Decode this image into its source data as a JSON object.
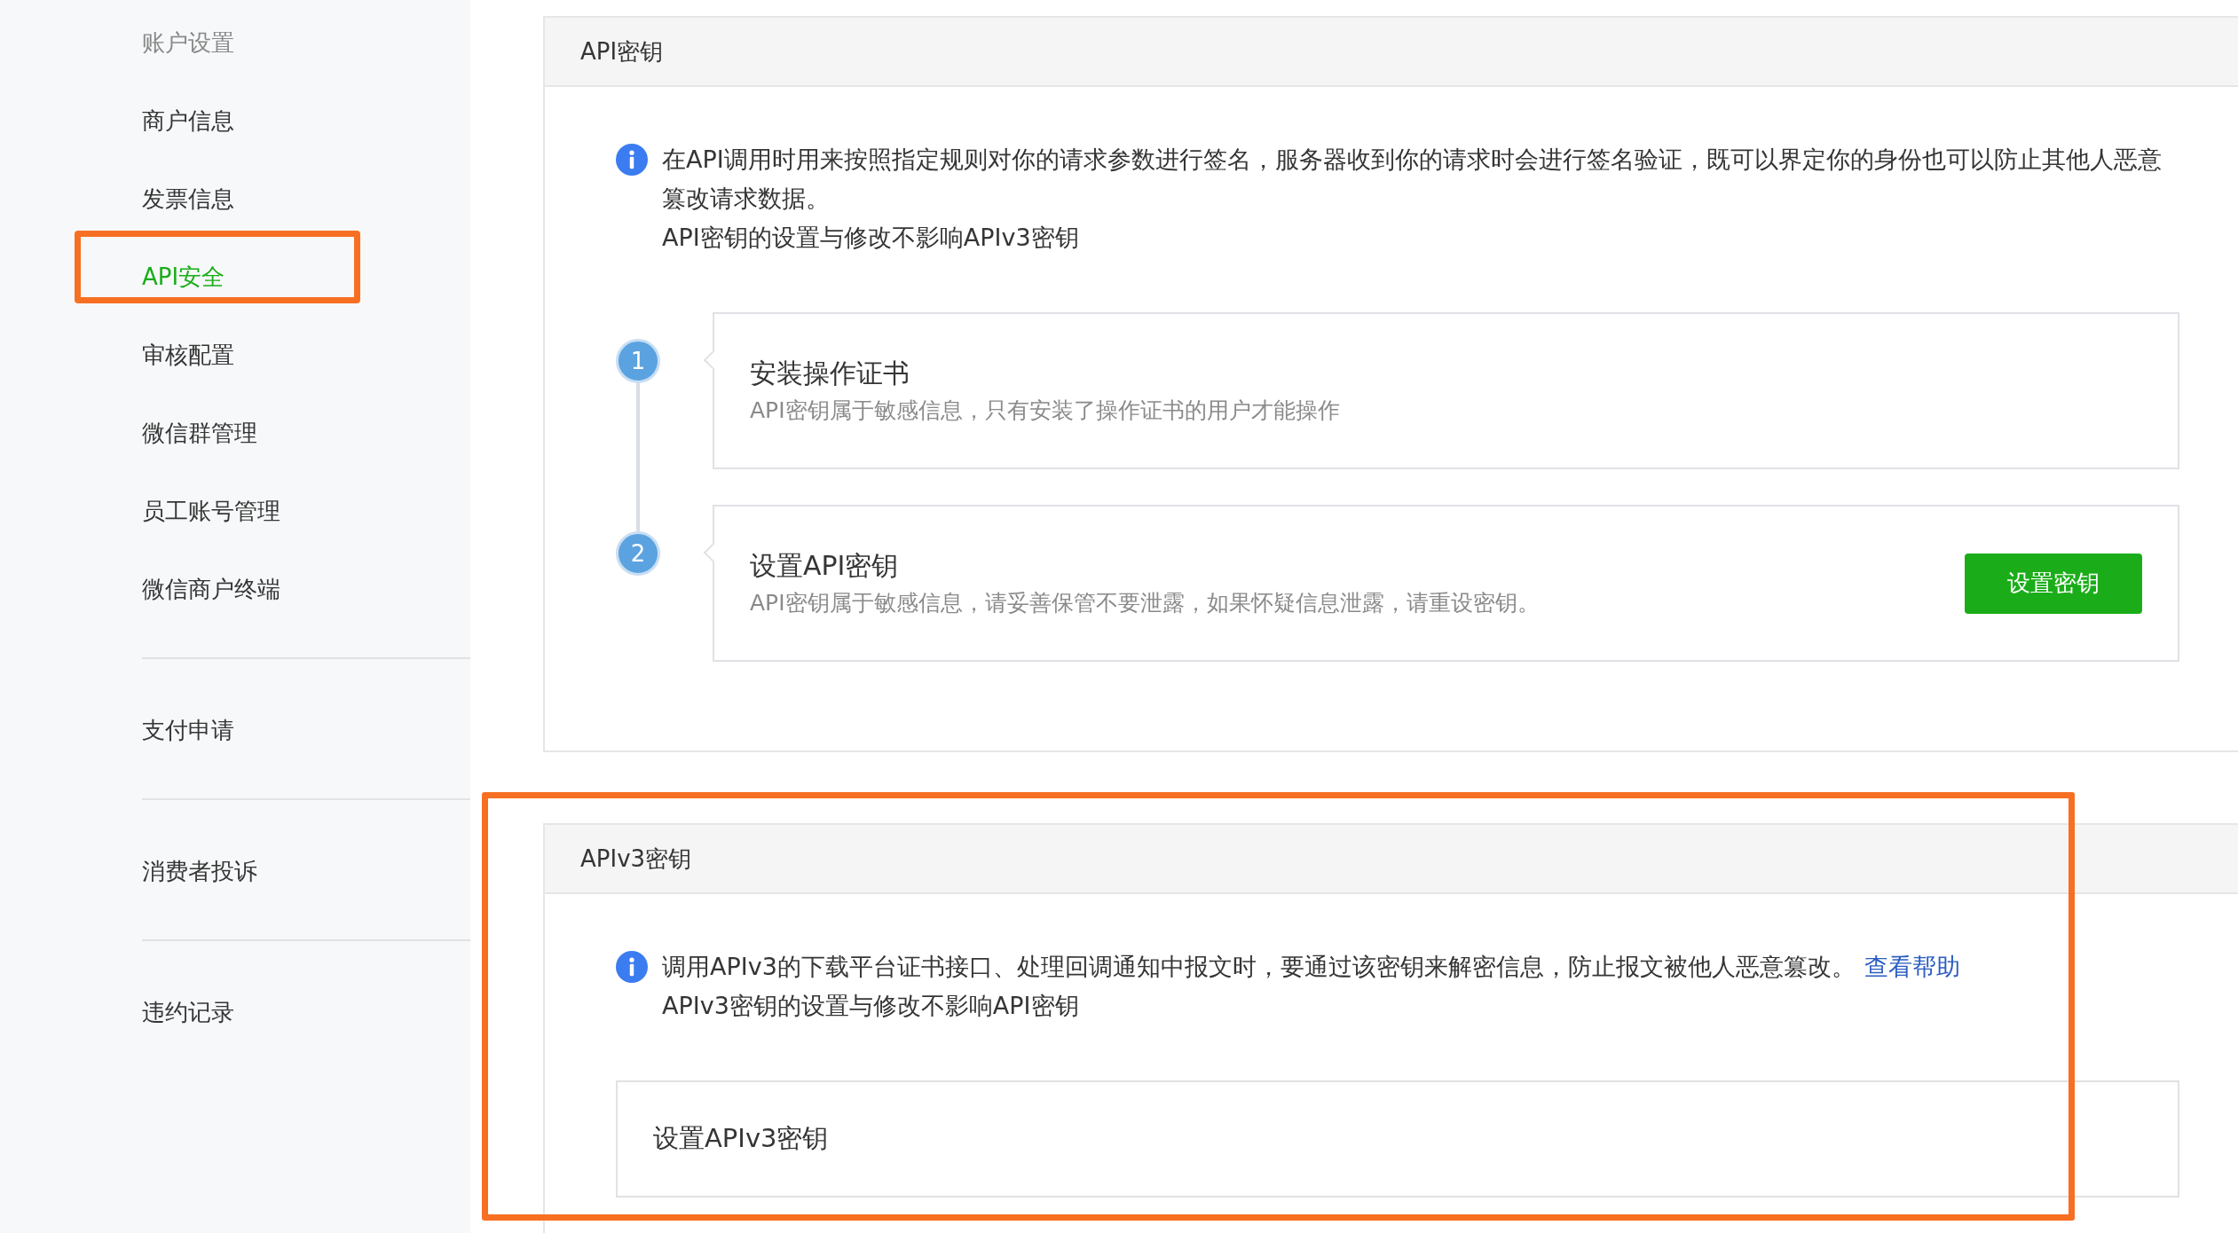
{
  "sidebar": {
    "heading": "账户设置",
    "sections": [
      [
        {
          "label": "商户信息",
          "selected": false,
          "highlighted": false
        },
        {
          "label": "发票信息",
          "selected": false,
          "highlighted": false
        },
        {
          "label": "API安全",
          "selected": true,
          "highlighted": true
        },
        {
          "label": "审核配置",
          "selected": false,
          "highlighted": false
        },
        {
          "label": "微信群管理",
          "selected": false,
          "highlighted": false
        },
        {
          "label": "员工账号管理",
          "selected": false,
          "highlighted": false
        },
        {
          "label": "微信商户终端",
          "selected": false,
          "highlighted": false
        }
      ],
      [
        {
          "label": "支付申请",
          "selected": false,
          "highlighted": false
        }
      ],
      [
        {
          "label": "消费者投诉",
          "selected": false,
          "highlighted": false
        }
      ],
      [
        {
          "label": "违约记录",
          "selected": false,
          "highlighted": false
        }
      ]
    ]
  },
  "api_key_card": {
    "title": "API密钥",
    "notice": {
      "lines": [
        "在API调用时用来按照指定规则对你的请求参数进行签名，服务器收到你的请求时会进行签名验证，既可以界定你的身份也可以防止其他人恶意篡改请求数据。",
        "API密钥的设置与修改不影响APIv3密钥"
      ]
    },
    "steps": [
      {
        "number": "1",
        "title": "安装操作证书",
        "description": "API密钥属于敏感信息，只有安装了操作证书的用户才能操作"
      },
      {
        "number": "2",
        "title": "设置API密钥",
        "description": "API密钥属于敏感信息，请妥善保管不要泄露，如果怀疑信息泄露，请重设密钥。",
        "button": "设置密钥"
      }
    ]
  },
  "apiv3_card": {
    "title": "APIv3密钥",
    "highlighted": true,
    "notice": {
      "lines": [
        "调用APIv3的下载平台证书接口、处理回调通知中报文时，要通过该密钥来解密信息，防止报文被他人恶意篡改。",
        "APIv3密钥的设置与修改不影响API密钥"
      ],
      "link": "查看帮助"
    },
    "setting_box": {
      "title": "设置APIv3密钥"
    }
  }
}
